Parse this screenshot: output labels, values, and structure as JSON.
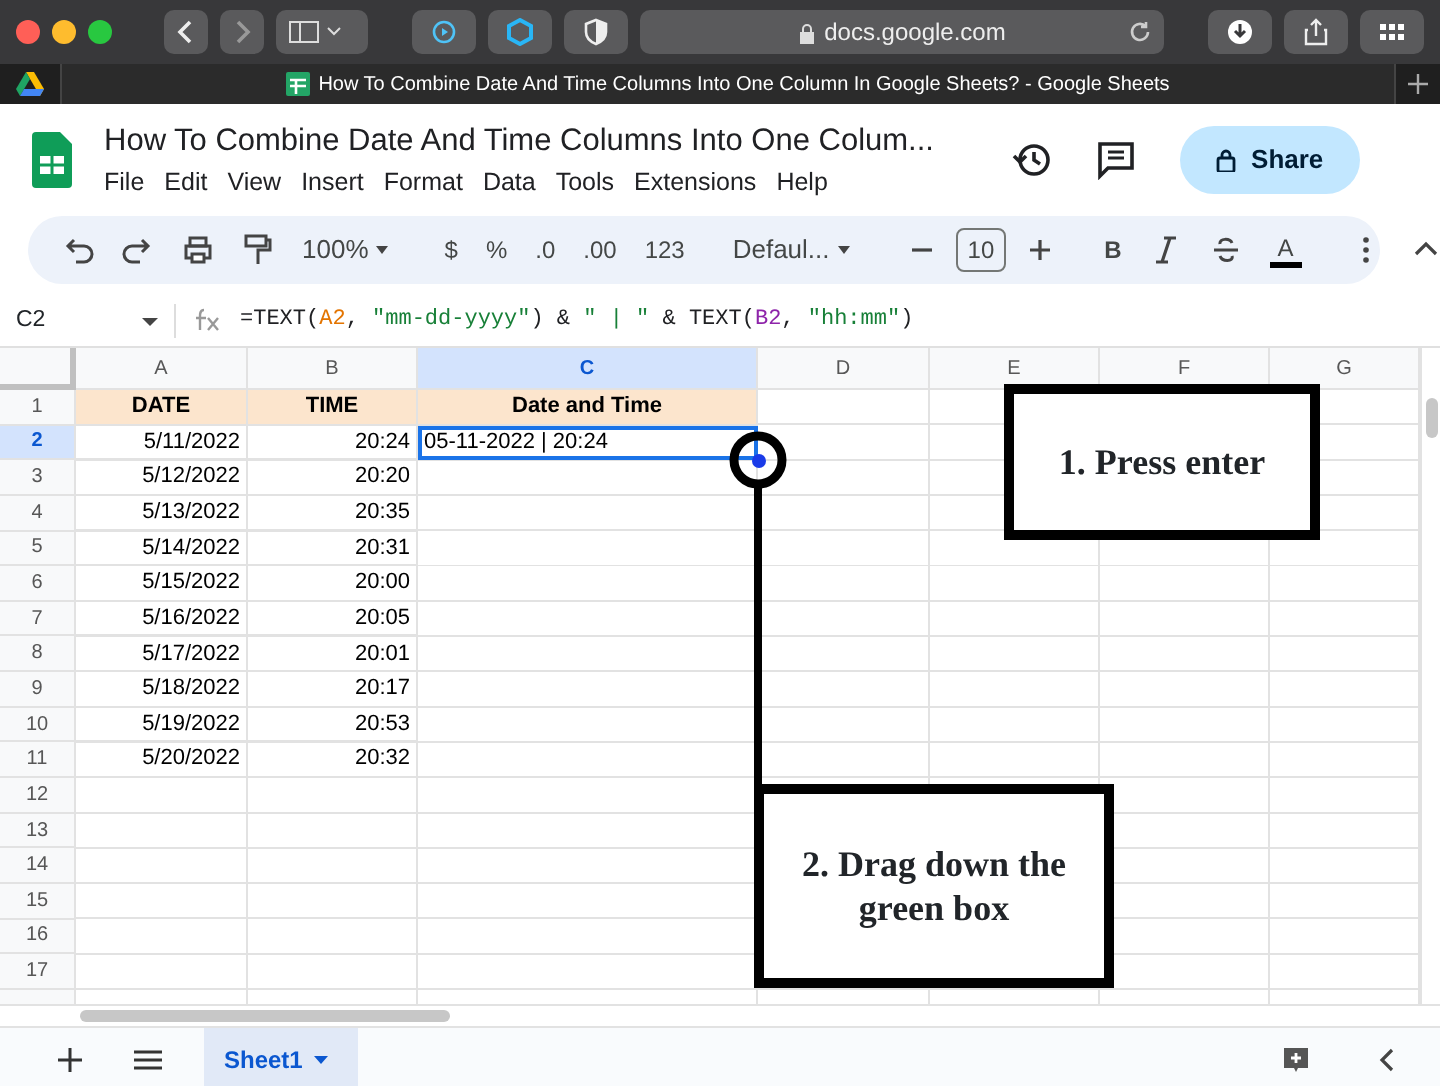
{
  "browser": {
    "url": "docs.google.com",
    "tab_title": "How To Combine Date And Time Columns Into One Column In Google Sheets? - Google Sheets"
  },
  "document": {
    "title": "How To Combine Date And Time Columns Into One Colum...",
    "menu": [
      "File",
      "Edit",
      "View",
      "Insert",
      "Format",
      "Data",
      "Tools",
      "Extensions",
      "Help"
    ],
    "share_label": "Share"
  },
  "toolbar": [
    {
      "kind": "icon"
    },
    {
      "kind": "icon"
    },
    {
      "kind": "icon"
    },
    {
      "kind": "icon"
    },
    {
      "kind": "dropdown",
      "label": "100%"
    },
    {
      "kind": "sep"
    },
    {
      "kind": "text",
      "label": "$"
    },
    {
      "kind": "text",
      "label": "%"
    },
    {
      "kind": "text",
      "label": ".0"
    },
    {
      "kind": "text",
      "label": ".00"
    },
    {
      "kind": "text",
      "label": "123"
    },
    {
      "kind": "sep"
    },
    {
      "kind": "dropdown",
      "label": "Defaul..."
    },
    {
      "kind": "sep"
    },
    {
      "kind": "icon"
    },
    {
      "kind": "field",
      "label": "10"
    },
    {
      "kind": "icon"
    },
    {
      "kind": "sep"
    },
    {
      "kind": "text",
      "label": "B"
    },
    {
      "kind": "icon"
    },
    {
      "kind": "icon"
    },
    {
      "kind": "color",
      "label": "A"
    },
    {
      "kind": "sep"
    },
    {
      "kind": "icon"
    },
    {
      "kind": "icon"
    }
  ],
  "formula_bar": {
    "cell_ref": "C2",
    "tokens": [
      {
        "text": "=TEXT(",
        "color": "#202124"
      },
      {
        "text": "A2",
        "color": "#e37400"
      },
      {
        "text": ", ",
        "color": "#202124"
      },
      {
        "text": "\"mm-dd-yyyy\"",
        "color": "#188038"
      },
      {
        "text": ") & ",
        "color": "#202124"
      },
      {
        "text": "\" | \"",
        "color": "#188038"
      },
      {
        "text": " & TEXT(",
        "color": "#202124"
      },
      {
        "text": "B2",
        "color": "#8e24aa"
      },
      {
        "text": ", ",
        "color": "#202124"
      },
      {
        "text": "\"hh:mm\"",
        "color": "#188038"
      },
      {
        "text": ")",
        "color": "#202124"
      }
    ]
  },
  "sheet": {
    "columns": [
      {
        "label": "A",
        "selected": false
      },
      {
        "label": "B",
        "selected": false
      },
      {
        "label": "C",
        "selected": true
      },
      {
        "label": "D",
        "selected": false
      },
      {
        "label": "E",
        "selected": false
      },
      {
        "label": "F",
        "selected": false
      },
      {
        "label": "G",
        "selected": false
      }
    ],
    "rows": [
      {
        "number": "1",
        "selected": false,
        "kind": "header",
        "cells": [
          "DATE",
          "TIME",
          "Date and Time"
        ]
      },
      {
        "number": "2",
        "selected": true,
        "kind": "data",
        "cells": [
          "5/11/2022",
          "20:24",
          "05-11-2022 | 20:24"
        ]
      },
      {
        "number": "3",
        "selected": false,
        "kind": "data",
        "cells": [
          "5/12/2022",
          "20:20"
        ]
      },
      {
        "number": "4",
        "selected": false,
        "kind": "data",
        "cells": [
          "5/13/2022",
          "20:35"
        ]
      },
      {
        "number": "5",
        "selected": false,
        "kind": "data",
        "cells": [
          "5/14/2022",
          "20:31"
        ]
      },
      {
        "number": "6",
        "selected": false,
        "kind": "data",
        "cells": [
          "5/15/2022",
          "20:00"
        ]
      },
      {
        "number": "7",
        "selected": false,
        "kind": "data",
        "cells": [
          "5/16/2022",
          "20:05"
        ]
      },
      {
        "number": "8",
        "selected": false,
        "kind": "data",
        "cells": [
          "5/17/2022",
          "20:01"
        ]
      },
      {
        "number": "9",
        "selected": false,
        "kind": "data",
        "cells": [
          "5/18/2022",
          "20:17"
        ]
      },
      {
        "number": "10",
        "selected": false,
        "kind": "data",
        "cells": [
          "5/19/2022",
          "20:53"
        ]
      },
      {
        "number": "11",
        "selected": false,
        "kind": "data",
        "cells": [
          "5/20/2022",
          "20:32"
        ]
      },
      {
        "number": "12",
        "selected": false,
        "kind": "data",
        "cells": []
      },
      {
        "number": "13",
        "selected": false,
        "kind": "data",
        "cells": []
      },
      {
        "number": "14",
        "selected": false,
        "kind": "data",
        "cells": []
      },
      {
        "number": "15",
        "selected": false,
        "kind": "data",
        "cells": []
      },
      {
        "number": "16",
        "selected": false,
        "kind": "data",
        "cells": []
      },
      {
        "number": "17",
        "selected": false,
        "kind": "data",
        "cells": []
      }
    ],
    "tabs": [
      {
        "label": "Sheet1",
        "selected": true
      }
    ]
  },
  "annotations": [
    {
      "text": "1. Press enter"
    },
    {
      "text": "2. Drag down the green box"
    }
  ]
}
